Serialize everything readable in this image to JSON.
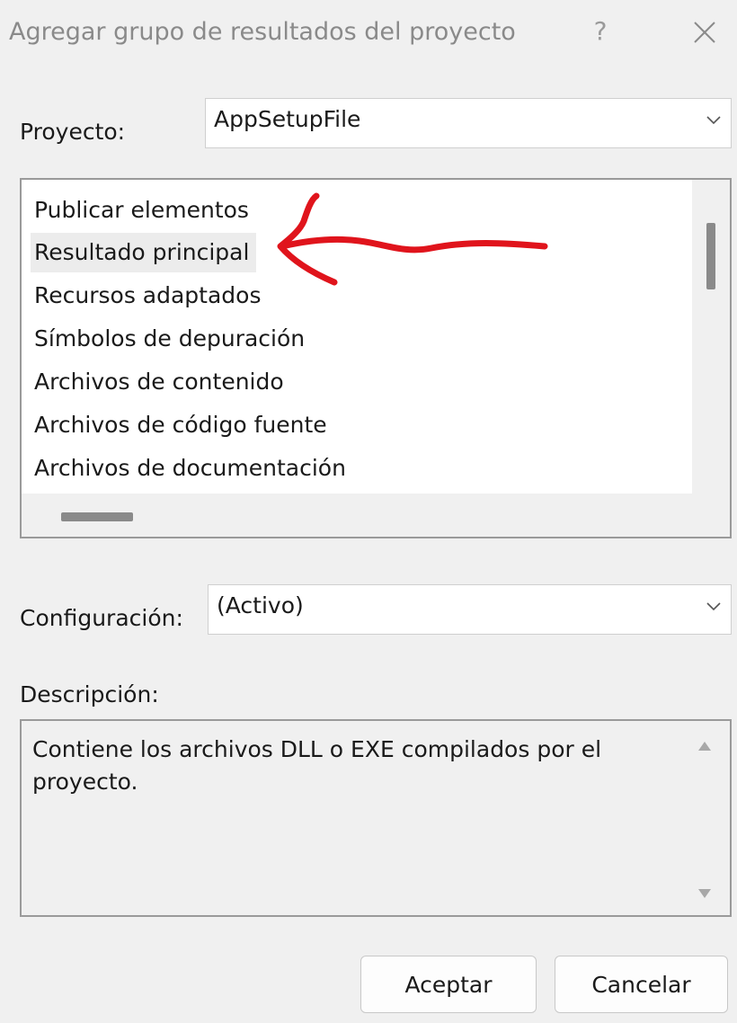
{
  "window": {
    "title": "Agregar grupo de resultados del proyecto",
    "help_glyph": "?"
  },
  "project": {
    "label": "Proyecto:",
    "selected": "AppSetupFile"
  },
  "outputs": {
    "items": [
      "Publicar elementos",
      "Resultado principal",
      "Recursos adaptados",
      "Símbolos de depuración",
      "Archivos de contenido",
      "Archivos de código fuente",
      "Archivos de documentación"
    ],
    "selected_index": 1
  },
  "configuration": {
    "label": "Configuración:",
    "selected": "(Activo)"
  },
  "description": {
    "label": "Descripción:",
    "text": "Contiene los archivos DLL o EXE compilados por el proyecto."
  },
  "buttons": {
    "ok": "Aceptar",
    "cancel": "Cancelar"
  },
  "annotation": {
    "color": "#e0141c"
  }
}
